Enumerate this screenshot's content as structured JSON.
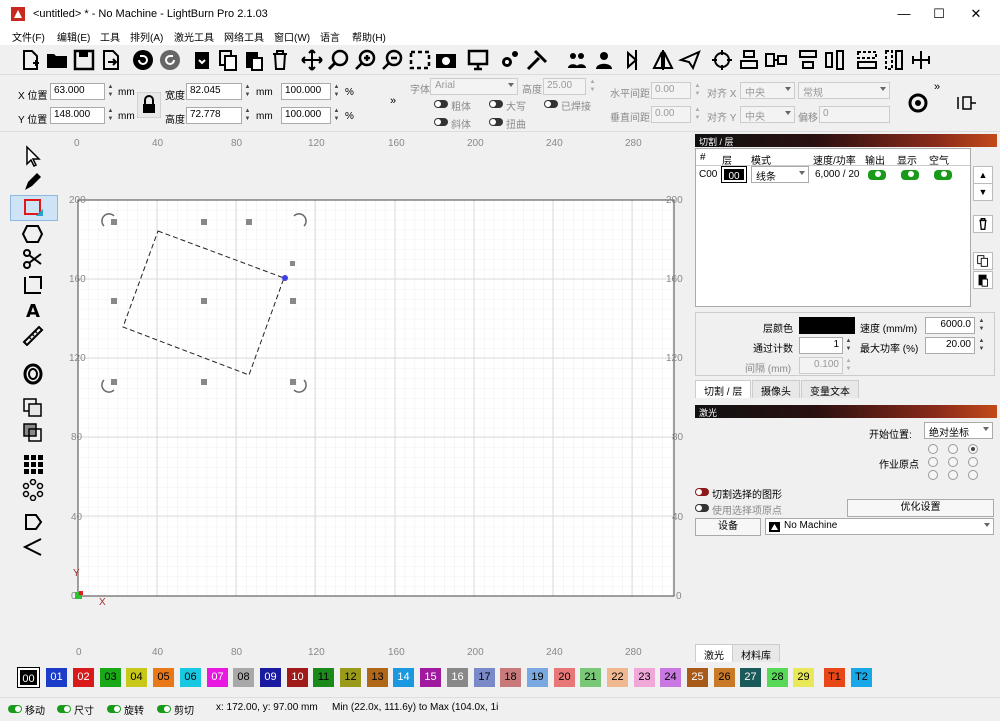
{
  "window": {
    "title": "<untitled> * - No Machine - LightBurn Pro 2.1.03",
    "min": "—",
    "max": "☐",
    "close": "✕"
  },
  "menu": [
    "文件(F)",
    "编辑(E)",
    "工具",
    "排列(A)",
    "激光工具",
    "网络工具",
    "窗口(W)",
    "语言",
    "帮助(H)"
  ],
  "props": {
    "x_label": "X 位置",
    "x_value": "63.000",
    "y_label": "Y 位置",
    "y_value": "148.000",
    "unit": "mm",
    "width_label": "宽度",
    "width_value": "82.045",
    "height_label": "高度",
    "height_value": "72.778",
    "pct1": "100.000",
    "pct2": "100.000",
    "pct_sign": "%",
    "more": "»",
    "font_label": "字体",
    "font_value": "Arial",
    "fheight_label": "高度",
    "fheight_value": "25.00",
    "bold": "粗体",
    "upper": "大写",
    "welded": "已焊接",
    "italic": "斜体",
    "distort": "扭曲",
    "hspace_label": "水平间距",
    "hspace_value": "0.00",
    "alignx_label": "对齐 X",
    "alignx_value": "中央",
    "style_value": "常规",
    "vspace_label": "垂直间距",
    "vspace_value": "0.00",
    "aligny_label": "对齐 Y",
    "aligny_value": "中央",
    "offset_label": "偏移",
    "offset_value": "0"
  },
  "rulers": {
    "top": [
      "0",
      "40",
      "80",
      "120",
      "160",
      "200",
      "240",
      "280"
    ],
    "left": [
      "200",
      "160",
      "120",
      "80",
      "40",
      "0"
    ],
    "right": [
      "200",
      "160",
      "120",
      "80",
      "40",
      "0"
    ]
  },
  "axes": {
    "y": "Y",
    "x": "X"
  },
  "cut_panel": {
    "title": "切割 / 层",
    "headers": [
      "#",
      "层",
      "模式",
      "速度/功率",
      "输出",
      "显示",
      "空气"
    ],
    "row": {
      "num": "C00",
      "layer": "00",
      "mode": "线条",
      "speed": "6,000 / 20"
    },
    "layer_color_label": "层颜色",
    "speed_label": "速度 (mm/m)",
    "speed_value": "6000.0",
    "passes_label": "通过计数",
    "passes_value": "1",
    "maxpower_label": "最大功率 (%)",
    "maxpower_value": "20.00",
    "interval_label": "间隔 (mm)",
    "interval_value": "0.100",
    "tabs": [
      "切割 / 层",
      "摄像头",
      "变量文本"
    ]
  },
  "laser_panel": {
    "title": "激光",
    "start_label": "开始位置:",
    "start_value": "绝对坐标",
    "origin_label": "作业原点",
    "cut_selected": "切割选择的图形",
    "use_origin": "使用选择项原点",
    "optimize": "优化设置",
    "device": "设备",
    "machine": "No Machine",
    "tabs": [
      "激光",
      "材料库"
    ]
  },
  "palette": [
    {
      "n": "00",
      "c": "#000000",
      "t": "#ffffff"
    },
    {
      "n": "01",
      "c": "#1a3cc8",
      "t": "#ffffff"
    },
    {
      "n": "02",
      "c": "#d81a1a",
      "t": "#ffffff"
    },
    {
      "n": "03",
      "c": "#18a818",
      "t": "#000000"
    },
    {
      "n": "04",
      "c": "#c8c818",
      "t": "#000000"
    },
    {
      "n": "05",
      "c": "#e87818",
      "t": "#000000"
    },
    {
      "n": "06",
      "c": "#18c8e0",
      "t": "#000000"
    },
    {
      "n": "07",
      "c": "#e818e0",
      "t": "#ffffff"
    },
    {
      "n": "08",
      "c": "#a8a8a8",
      "t": "#000000"
    },
    {
      "n": "09",
      "c": "#1a1aa0",
      "t": "#ffffff"
    },
    {
      "n": "10",
      "c": "#a01a1a",
      "t": "#ffffff"
    },
    {
      "n": "11",
      "c": "#1a8a1a",
      "t": "#000000"
    },
    {
      "n": "12",
      "c": "#9a9a1a",
      "t": "#000000"
    },
    {
      "n": "13",
      "c": "#b06818",
      "t": "#000000"
    },
    {
      "n": "14",
      "c": "#1a98e0",
      "t": "#ffffff"
    },
    {
      "n": "15",
      "c": "#a01aa0",
      "t": "#ffffff"
    },
    {
      "n": "16",
      "c": "#888888",
      "t": "#ffffff"
    },
    {
      "n": "17",
      "c": "#7a8ac8",
      "t": "#000000"
    },
    {
      "n": "18",
      "c": "#c87a7a",
      "t": "#000000"
    },
    {
      "n": "19",
      "c": "#7aa8e0",
      "t": "#000000"
    },
    {
      "n": "20",
      "c": "#e87878",
      "t": "#000000"
    },
    {
      "n": "21",
      "c": "#78c878",
      "t": "#000000"
    },
    {
      "n": "22",
      "c": "#f0b890",
      "t": "#000000"
    },
    {
      "n": "23",
      "c": "#f0a8d8",
      "t": "#000000"
    },
    {
      "n": "24",
      "c": "#c878e0",
      "t": "#000000"
    },
    {
      "n": "25",
      "c": "#a85a18",
      "t": "#ffffff"
    },
    {
      "n": "26",
      "c": "#c87a28",
      "t": "#000000"
    },
    {
      "n": "27",
      "c": "#1a5a5a",
      "t": "#ffffff"
    },
    {
      "n": "28",
      "c": "#58d858",
      "t": "#000000"
    },
    {
      "n": "29",
      "c": "#e8e858",
      "t": "#000000"
    },
    {
      "n": "T1",
      "c": "#e84818",
      "t": "#000000"
    },
    {
      "n": "T2",
      "c": "#18a8e8",
      "t": "#000000"
    }
  ],
  "status": {
    "move": "移动",
    "size": "尺寸",
    "rotate": "旋转",
    "shear": "剪切",
    "coords": "x: 172.00, y: 97.00 mm",
    "range": "Min (22.0x, 111.6y) to Max (104.0x, 1i"
  }
}
